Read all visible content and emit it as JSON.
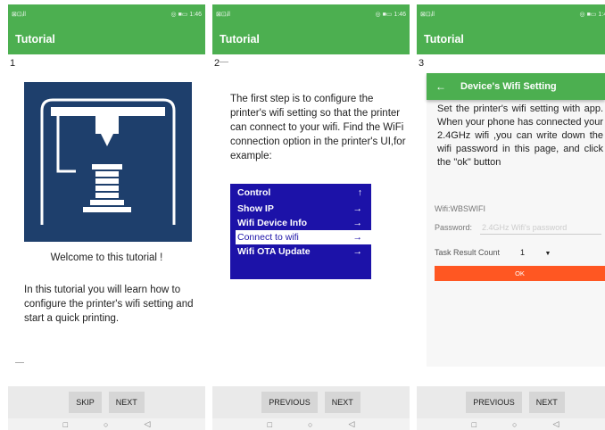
{
  "status_bar": {
    "signal": "⊠⊡ᵢll",
    "battery_time": "◎ ■▭ 1:46"
  },
  "app": {
    "title": "Tutorial"
  },
  "screens": [
    {
      "page_number": "1",
      "welcome": "Welcome to this tutorial !",
      "description": "In this tutorial you will learn how to configure the printer's wifi setting and start a quick printing.",
      "buttons": {
        "skip": "SKIP",
        "next": "NEXT"
      }
    },
    {
      "page_number": "2",
      "text": "The first step is to configure the printer's wifi setting so that the printer can connect to your wifi. Find the WiFi connection option in the printer's UI,for example:",
      "menu": [
        {
          "label": "Control",
          "arrow": "↑"
        },
        {
          "label": "Show IP",
          "arrow": "→"
        },
        {
          "label": "Wifi Device Info",
          "arrow": "→"
        },
        {
          "label": "Connect to wifi",
          "arrow": "→"
        },
        {
          "label": "Wifi OTA Update",
          "arrow": "→"
        }
      ],
      "buttons": {
        "previous": "PREVIOUS",
        "next": "NEXT"
      }
    },
    {
      "page_number": "3",
      "dialog_title": "Device's Wifi Setting",
      "back_arrow": "←",
      "text": "Set the printer's wifi setting with app. When your phone has connected your 2.4GHz wifi ,you can write down the wifi password in this page, and click the \"ok\" button",
      "wifi_label": "Wifi:WBSWIFI",
      "password_label": "Password:",
      "password_placeholder": "2.4GHz Wifi's password",
      "task_label": "Task Result Count",
      "task_value": "1",
      "ok": "OK",
      "buttons": {
        "previous": "PREVIOUS",
        "next": "NEXT"
      }
    }
  ],
  "nav": {
    "overview": "□",
    "home": "○",
    "back": "◁"
  },
  "colors": {
    "green": "#4caf50",
    "menu_blue": "#1c12a8",
    "logo_blue": "#1e3f6c",
    "ok_orange": "#ff5722"
  }
}
